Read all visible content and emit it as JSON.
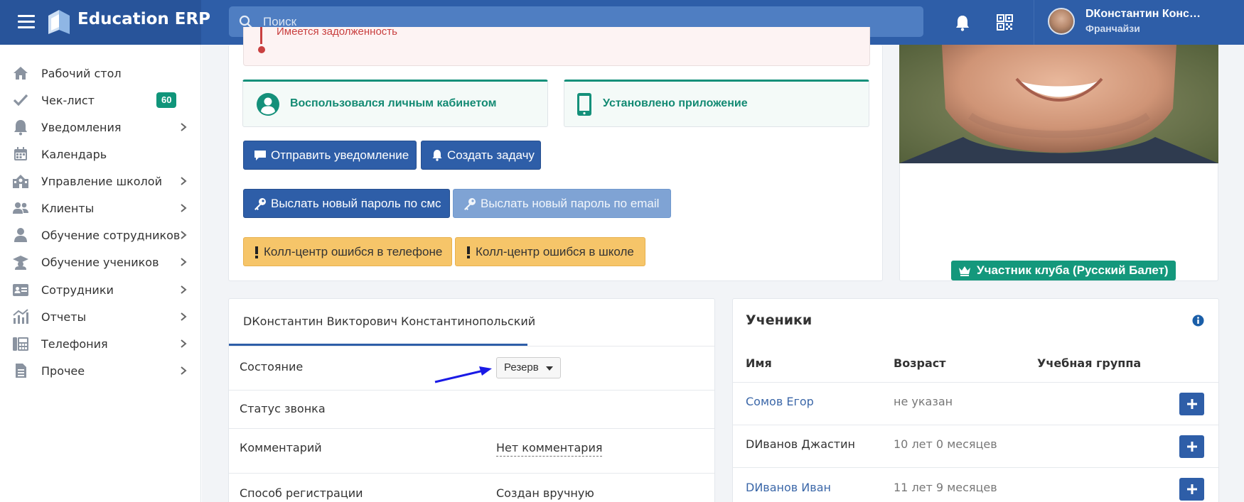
{
  "header": {
    "app_name": "Education ERP",
    "search_placeholder": "Поиск",
    "user_name": "DКонстантин Конс…",
    "user_role": "Франчайзи"
  },
  "sidebar": {
    "items": [
      {
        "label": "Рабочий стол",
        "icon": "home-icon"
      },
      {
        "label": "Чек-лист",
        "icon": "check-icon",
        "badge": "60"
      },
      {
        "label": "Уведомления",
        "icon": "bell-icon"
      },
      {
        "label": "Календарь",
        "icon": "calendar-icon"
      },
      {
        "label": "Управление школой",
        "icon": "school-icon"
      },
      {
        "label": "Клиенты",
        "icon": "users-icon"
      },
      {
        "label": "Обучение сотрудников",
        "icon": "staff-training-icon"
      },
      {
        "label": "Обучение учеников",
        "icon": "graduation-cap-icon"
      },
      {
        "label": "Сотрудники",
        "icon": "id-card-icon"
      },
      {
        "label": "Отчеты",
        "icon": "chart-icon"
      },
      {
        "label": "Телефония",
        "icon": "phone-fax-icon"
      },
      {
        "label": "Прочее",
        "icon": "document-icon"
      }
    ]
  },
  "alerts": {
    "debt": "Имеется задолженность"
  },
  "info_boxes": {
    "cabinet": "Воспользовался личным кабинетом",
    "app": "Установлено приложение"
  },
  "actions": {
    "send_notification": "Отправить уведомление",
    "create_task": "Создать задачу",
    "new_password_sms": "Выслать новый пароль по смс",
    "new_password_email": "Выслать новый пароль по email",
    "callcenter_phone": "Колл-центр ошибся в телефоне",
    "callcenter_school": "Колл-центр ошибся в школе"
  },
  "club_badge": "Участник клуба (Русский Балет)",
  "client": {
    "tab_title": "DКонстантин Викторович Константинопольский",
    "rows": {
      "state_label": "Состояние",
      "state_value": "Резерв",
      "call_status_label": "Статус звонка",
      "comment_label": "Комментарий",
      "comment_value": "Нет комментария",
      "registration_label": "Способ регистрации",
      "registration_value": "Создан вручную"
    }
  },
  "students": {
    "title": "Ученики",
    "columns": [
      "Имя",
      "Возраст",
      "Учебная группа"
    ],
    "rows": [
      {
        "name": "Сомов Егор",
        "age": "не указан",
        "link": true
      },
      {
        "name": "DИванов Джастин",
        "age": "10 лет 0 месяцев",
        "link": false
      },
      {
        "name": "DИванов Иван",
        "age": "11 лет 9 месяцев",
        "link": true
      }
    ]
  },
  "colors": {
    "primary": "#2e5ea8",
    "header_dark": "#28549a",
    "green": "#14907a",
    "warning": "#f6c569",
    "danger": "#c94040"
  }
}
